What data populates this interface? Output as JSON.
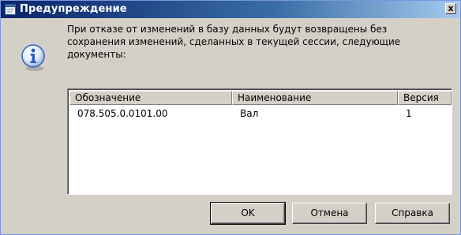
{
  "window": {
    "title": "Предупреждение",
    "close_glyph": "x"
  },
  "message": "При отказе от изменений в базу данных будут возвращены без сохранения изменений, сделанных в текущей сессии, следующие документы:",
  "table": {
    "columns": [
      "Обозначение",
      "Наименование",
      "Версия"
    ],
    "rows": [
      [
        "078.505.0.0101.00",
        "Вал",
        "1"
      ]
    ]
  },
  "buttons": {
    "ok": "OK",
    "cancel": "Отмена",
    "help": "Справка"
  },
  "icons": {
    "title": "dialog-icon",
    "info": "info-icon"
  },
  "colors": {
    "titlebar_start": "#0a246a",
    "titlebar_end": "#a6caf0",
    "face": "#d4d0c8",
    "info_blue": "#2a5fbf"
  }
}
